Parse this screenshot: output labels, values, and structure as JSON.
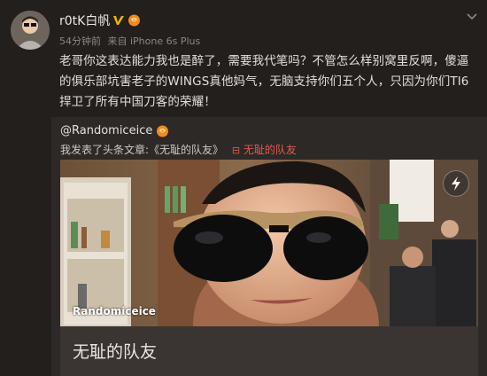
{
  "post": {
    "author": "r0tK白帆",
    "time": "54分钟前",
    "source": "来自 iPhone 6s Plus",
    "text": "老哥你这表达能力我也是醉了，需要我代笔吗？不管怎么样别窝里反啊，傻逼的俱乐部坑害老子的WINGS真他妈气，无脑支持你们五个人，只因为你们TI6捍卫了所有中国刀客的荣耀！"
  },
  "repost": {
    "author": "@Randomiceice",
    "text_prefix": "我发表了头条文章:《无耻的队友》",
    "link_label": "无耻的队友",
    "card": {
      "watermark": "Randomiceice",
      "title": "无耻的队友"
    }
  },
  "icons": {
    "verified": "verified-v-icon",
    "level": "vip-level-icon",
    "share": "lightning-share-icon",
    "link": "link-icon"
  },
  "colors": {
    "background": "#231f1d",
    "repost_bg": "#2d2927",
    "link": "#e05b4e",
    "verified": "#f4b400"
  }
}
